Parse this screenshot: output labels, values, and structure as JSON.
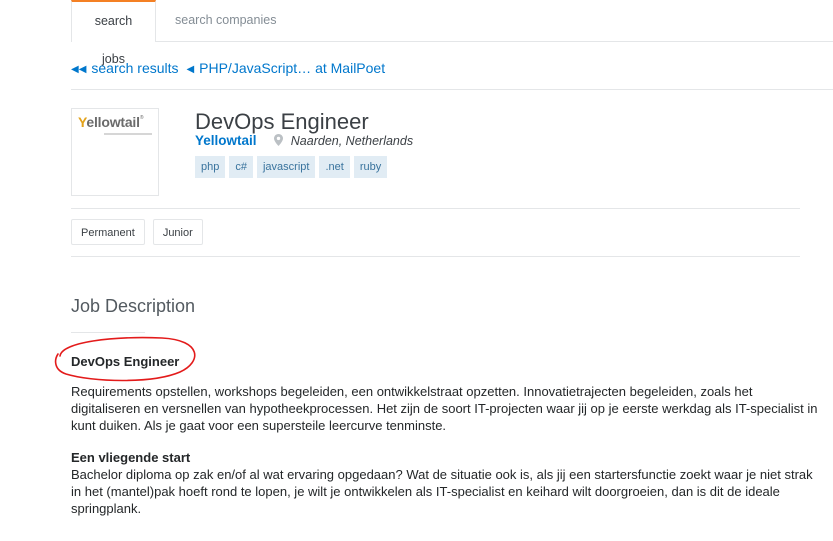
{
  "tabs": [
    {
      "label": "search jobs",
      "active": true
    },
    {
      "label": "search companies",
      "active": false
    }
  ],
  "colors": {
    "accent": "#f48024",
    "link": "#0077cc",
    "tag_bg": "#e1ecf4",
    "tag_text": "#39739d",
    "annotation": "#e31b1b"
  },
  "breadcrumb": {
    "back_icon": "double-chevron-left-icon",
    "items": [
      {
        "label": "search results",
        "icon": "double-chevron-left-icon"
      },
      {
        "label": "PHP/JavaScript… at MailPoet",
        "icon": "chevron-left-icon"
      }
    ]
  },
  "job": {
    "logo_text": "Yellowtail",
    "title": "DevOps Engineer",
    "company": "Yellowtail",
    "location_icon": "map-pin-icon",
    "location": "Naarden, Netherlands",
    "tags": [
      "php",
      "c#",
      "javascript",
      ".net",
      "ruby"
    ],
    "meta": [
      "Permanent",
      "Junior"
    ]
  },
  "description": {
    "section_title": "Job Description",
    "heading": "DevOps Engineer",
    "paragraph1": "Requirements opstellen, workshops begeleiden, een ontwikkelstraat opzetten. Innovatietrajecten begeleiden, zoals het digitaliseren en versnellen van hypotheekprocessen. Het zijn de soort IT-projecten waar jij op je eerste werkdag als IT-specialist in kunt duiken. Als je gaat voor een supersteile leercurve tenminste.",
    "subheading": "Een vliegende start",
    "paragraph2": "Bachelor diploma op zak en/of al wat ervaring opgedaan? Wat de situatie ook is, als jij een startersfunctie zoekt waar je niet strak in het (mantel)pak hoeft rond te lopen, je wilt je ontwikkelen als IT-specialist en keihard wilt doorgroeien, dan is dit de ideale springplank."
  }
}
